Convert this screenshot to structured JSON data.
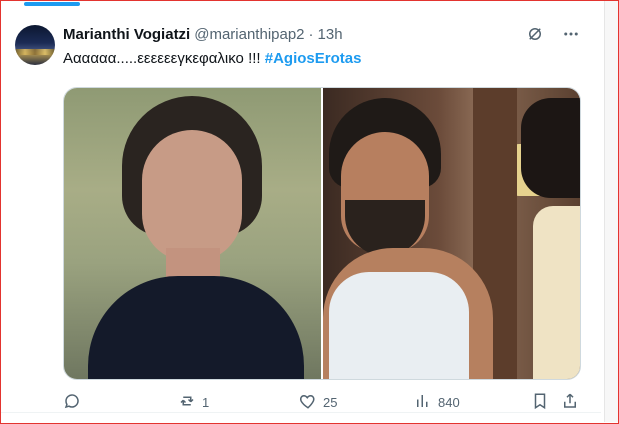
{
  "tweet": {
    "name": "Marianthi Vogiatzi",
    "handle": "@marianthipap2",
    "separator": "·",
    "time": "13h",
    "text": "Αααααα.....εεεεεεγκεφαλικο !!!",
    "hashtag": "#AgiosErotas"
  },
  "icons": {
    "grok": "grok-icon",
    "more": "more-icon",
    "reply": "reply-icon",
    "retweet": "retweet-icon",
    "like": "like-icon",
    "views": "views-icon",
    "bookmark": "bookmark-icon",
    "share": "share-icon"
  },
  "actions": {
    "reply_count": "",
    "retweet_count": "1",
    "like_count": "25",
    "view_count": "840"
  },
  "colors": {
    "accent": "#1d9bf0",
    "muted": "#536471",
    "text": "#0f1419",
    "border": "#e3342f"
  }
}
